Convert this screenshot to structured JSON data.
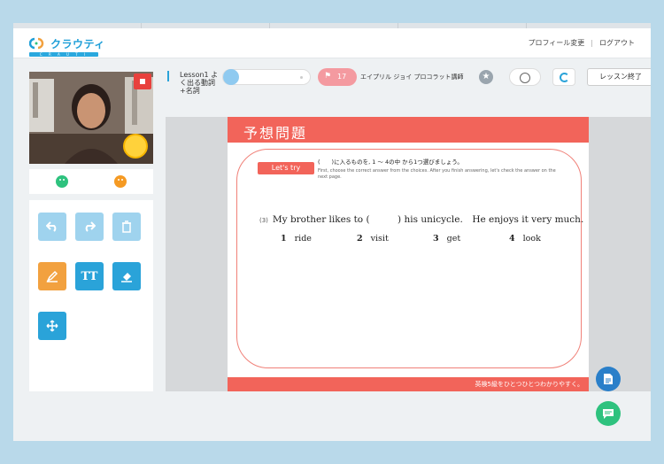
{
  "app": {
    "logo_text": "クラウティ",
    "logo_sub": "C R A U T I"
  },
  "nav": {
    "profile_label": "プロフィール変更",
    "separator": "|",
    "logout_label": "ログアウト"
  },
  "lesson": {
    "title": "Lesson1 よく出る動詞+名詞"
  },
  "teacher": {
    "badge_number": "17",
    "name": "エイプリル ジョイ プロコラット講師"
  },
  "controls": {
    "end_label": "レッスン終了"
  },
  "tools": [
    {
      "name": "undo",
      "icon": "undo-icon",
      "enabled": false
    },
    {
      "name": "redo",
      "icon": "redo-icon",
      "enabled": false
    },
    {
      "name": "delete",
      "icon": "trash-icon",
      "enabled": false
    },
    {
      "name": "pen",
      "icon": "pen-icon",
      "enabled": true
    },
    {
      "name": "text",
      "icon": "text-icon",
      "enabled": true,
      "glyph": "TT"
    },
    {
      "name": "eraser",
      "icon": "eraser-icon",
      "enabled": true
    },
    {
      "name": "move",
      "icon": "move-icon",
      "enabled": true
    }
  ],
  "slide": {
    "title": "予想問題",
    "lets_try": "Let's try",
    "instruction_jp": "(　　)に入るものを, 1 ～ 4の中 から1つ選びましょう。",
    "instruction_en": "First, choose the correct answer from the choices. After you finish answering, let's check the answer on the next page.",
    "question_number": "(3)",
    "question_text": "My brother likes to (　　　) his unicycle.　He enjoys it very much.",
    "choices": [
      {
        "num": "1",
        "text": "ride"
      },
      {
        "num": "2",
        "text": "visit"
      },
      {
        "num": "3",
        "text": "get"
      },
      {
        "num": "4",
        "text": "look"
      }
    ],
    "footer": "英検5級をひとつひとつわかりやすく。"
  },
  "colors": {
    "accent": "#2aa3d9",
    "slide_red": "#f2645a",
    "teacher_pink": "#f49aa0",
    "good": "#2ec27e",
    "bad": "#f59a23"
  }
}
